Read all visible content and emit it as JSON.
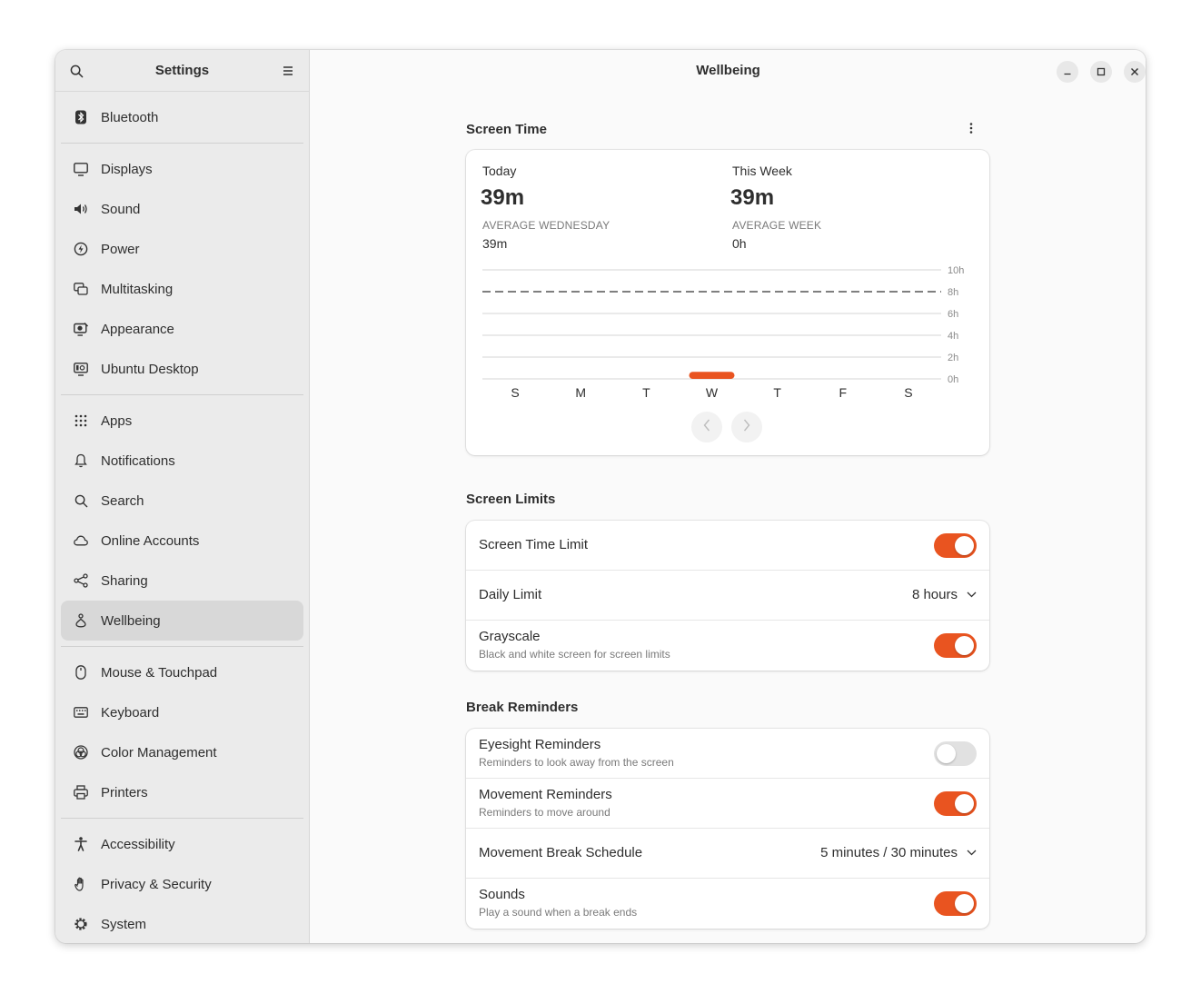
{
  "sidebar": {
    "title": "Settings",
    "search_icon": "search-icon",
    "menu_icon": "hamburger-menu-icon",
    "items": [
      {
        "id": "bluetooth",
        "label": "Bluetooth",
        "icon": "bluetooth-icon"
      },
      {
        "id": "displays",
        "label": "Displays",
        "icon": "monitor-icon"
      },
      {
        "id": "sound",
        "label": "Sound",
        "icon": "speaker-icon"
      },
      {
        "id": "power",
        "label": "Power",
        "icon": "power-icon"
      },
      {
        "id": "multitasking",
        "label": "Multitasking",
        "icon": "multitasking-icon"
      },
      {
        "id": "appearance",
        "label": "Appearance",
        "icon": "appearance-icon"
      },
      {
        "id": "ubuntu-desktop",
        "label": "Ubuntu Desktop",
        "icon": "ubuntu-desktop-icon"
      },
      {
        "id": "apps",
        "label": "Apps",
        "icon": "apps-grid-icon"
      },
      {
        "id": "notifications",
        "label": "Notifications",
        "icon": "bell-icon"
      },
      {
        "id": "search",
        "label": "Search",
        "icon": "search-icon"
      },
      {
        "id": "online-accounts",
        "label": "Online Accounts",
        "icon": "cloud-icon"
      },
      {
        "id": "sharing",
        "label": "Sharing",
        "icon": "share-icon"
      },
      {
        "id": "wellbeing",
        "label": "Wellbeing",
        "icon": "wellbeing-icon",
        "active": true
      },
      {
        "id": "mouse-touchpad",
        "label": "Mouse & Touchpad",
        "icon": "mouse-icon"
      },
      {
        "id": "keyboard",
        "label": "Keyboard",
        "icon": "keyboard-icon"
      },
      {
        "id": "color-management",
        "label": "Color Management",
        "icon": "color-management-icon"
      },
      {
        "id": "printers",
        "label": "Printers",
        "icon": "printer-icon"
      },
      {
        "id": "accessibility",
        "label": "Accessibility",
        "icon": "accessibility-icon"
      },
      {
        "id": "privacy-security",
        "label": "Privacy & Security",
        "icon": "hand-icon"
      },
      {
        "id": "system",
        "label": "System",
        "icon": "gear-icon"
      }
    ]
  },
  "header": {
    "title": "Wellbeing"
  },
  "window_controls": {
    "minimize_icon": "minimize-icon",
    "maximize_icon": "maximize-icon",
    "close_icon": "close-icon"
  },
  "screen_time": {
    "title": "Screen Time",
    "menu_icon": "kebab-menu-icon",
    "today_label": "Today",
    "today_value": "39m",
    "avg_day_label": "AVERAGE WEDNESDAY",
    "avg_day_value": "39m",
    "week_label": "This Week",
    "week_value": "39m",
    "avg_week_label": "AVERAGE WEEK",
    "avg_week_value": "0h",
    "prev_icon": "chevron-left-icon",
    "next_icon": "chevron-right-icon"
  },
  "chart_data": {
    "type": "bar",
    "categories": [
      "S",
      "M",
      "T",
      "W",
      "T",
      "F",
      "S"
    ],
    "values": [
      0,
      0,
      0,
      0.65,
      0,
      0,
      0
    ],
    "y_ticks": [
      "0h",
      "2h",
      "4h",
      "6h",
      "8h",
      "10h"
    ],
    "ylim": [
      0,
      10
    ],
    "limit_line": 8,
    "grid": true,
    "bar_color": "#e95420"
  },
  "screen_limits": {
    "title": "Screen Limits",
    "screen_time_limit_label": "Screen Time Limit",
    "screen_time_limit_on": true,
    "daily_limit_label": "Daily Limit",
    "daily_limit_value": "8 hours",
    "grayscale_label": "Grayscale",
    "grayscale_sub": "Black and white screen for screen limits",
    "grayscale_on": true
  },
  "break_reminders": {
    "title": "Break Reminders",
    "eyesight_label": "Eyesight Reminders",
    "eyesight_sub": "Reminders to look away from the screen",
    "eyesight_on": false,
    "movement_label": "Movement Reminders",
    "movement_sub": "Reminders to move around",
    "movement_on": true,
    "schedule_label": "Movement Break Schedule",
    "schedule_value": "5 minutes / 30 minutes",
    "sounds_label": "Sounds",
    "sounds_sub": "Play a sound when a break ends",
    "sounds_on": true
  },
  "colors": {
    "accent": "#e95420",
    "sidebar_bg": "#ebebeb",
    "content_bg": "#fafafa"
  }
}
